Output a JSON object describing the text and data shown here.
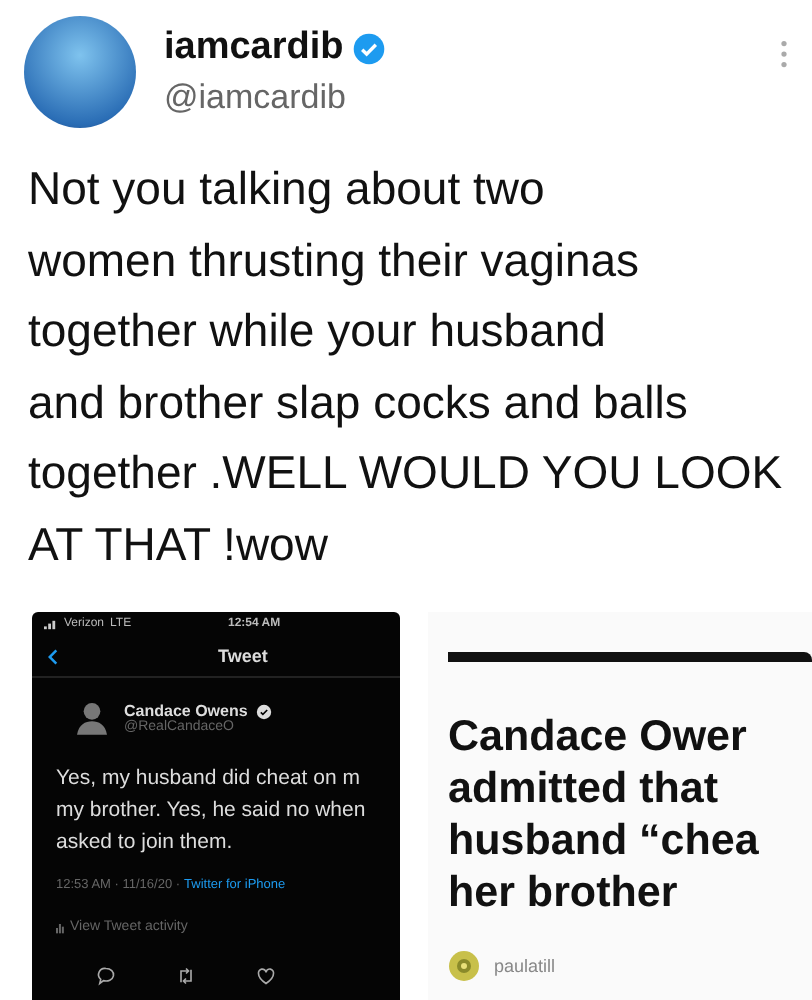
{
  "author": {
    "name": "iamcardib",
    "handle": "@iamcardib",
    "verified": true
  },
  "tweet_lines": [
    "Not you talking about two",
    "women thrusting their vaginas",
    "together while your husband",
    "and brother slap cocks and balls",
    "together .WELL WOULD YOU LOOK",
    "AT THAT !wow"
  ],
  "media": [
    {
      "kind": "tweet_screenshot",
      "carrier": "Verizon",
      "network": "LTE",
      "time": "12:54 AM",
      "header": "Tweet",
      "author": {
        "name": "Candace Owens",
        "handle": "@RealCandaceO",
        "verified": true
      },
      "body_lines": [
        "Yes, my husband did cheat on m",
        "my brother. Yes, he said no when",
        "asked to join them."
      ],
      "meta": "12:53 AM · 11/16/20 ·",
      "source": "Twitter for iPhone",
      "activity": "View Tweet activity"
    },
    {
      "kind": "article",
      "headline_lines": [
        "Candace Ower",
        "admitted that",
        "husband “chea",
        "her brother"
      ],
      "author": "paulatill"
    }
  ]
}
